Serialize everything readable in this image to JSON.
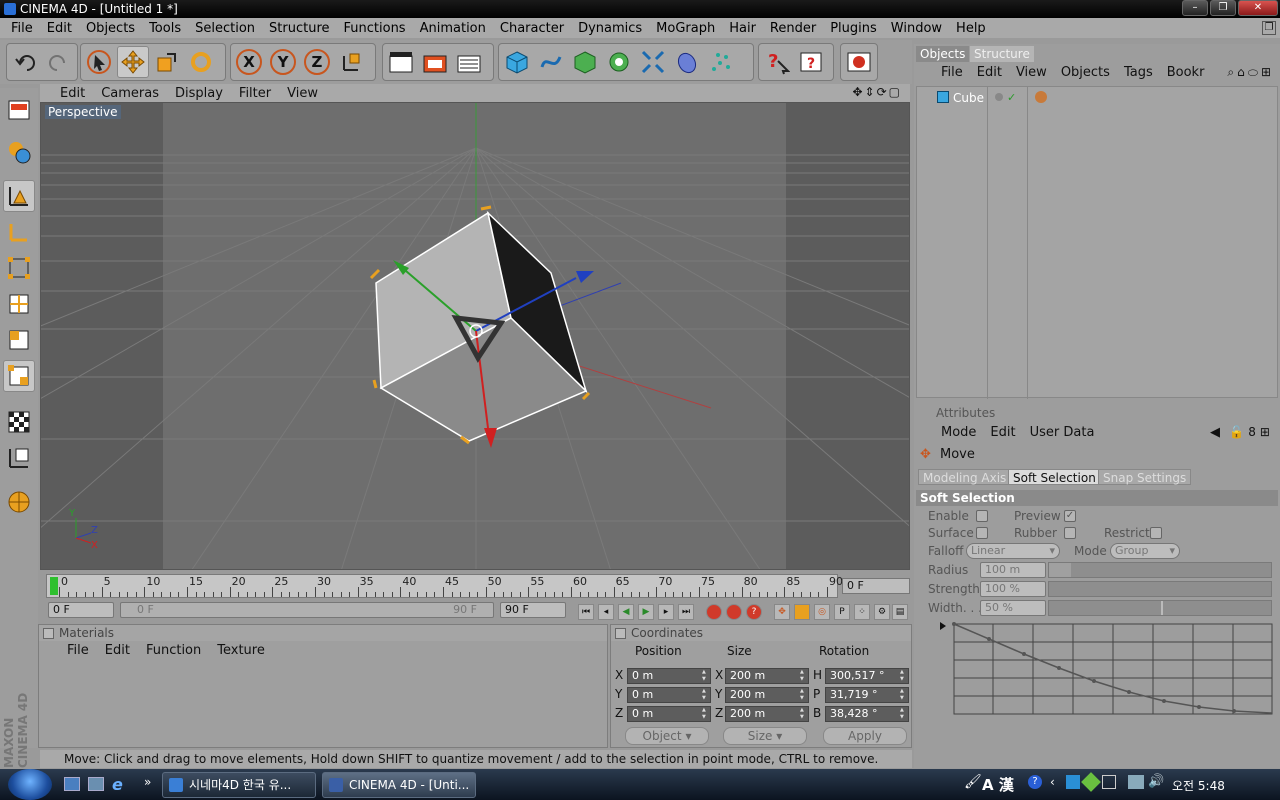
{
  "window": {
    "title": "CINEMA 4D - [Untitled 1 *]",
    "controls": [
      "–",
      "❐",
      "✕"
    ]
  },
  "menubar": [
    "File",
    "Edit",
    "Objects",
    "Tools",
    "Selection",
    "Structure",
    "Functions",
    "Animation",
    "Character",
    "Dynamics",
    "MoGraph",
    "Hair",
    "Render",
    "Plugins",
    "Window",
    "Help"
  ],
  "toolbar": {
    "axis_labels": [
      "X",
      "Y",
      "Z"
    ]
  },
  "viewport": {
    "menu": [
      "Edit",
      "Cameras",
      "Display",
      "Filter",
      "View"
    ],
    "label": "Perspective",
    "gizmo_axes": [
      "Y",
      "Z",
      "X"
    ]
  },
  "timeline": {
    "ticks": [
      "0",
      "5",
      "10",
      "15",
      "20",
      "25",
      "30",
      "35",
      "40",
      "45",
      "50",
      "55",
      "60",
      "65",
      "70",
      "75",
      "80",
      "85",
      "90"
    ],
    "current_frame": "0 F",
    "start_field": "0 F",
    "range_start": "0 F",
    "range_end": "90 F",
    "end_field": "90 F"
  },
  "materials": {
    "title": "Materials",
    "menu": [
      "File",
      "Edit",
      "Function",
      "Texture"
    ]
  },
  "coordinates": {
    "title": "Coordinates",
    "headers": [
      "Position",
      "Size",
      "Rotation"
    ],
    "rows": [
      {
        "axis": "X",
        "pos": "0 m",
        "size_axis": "X",
        "size": "200 m",
        "rot_axis": "H",
        "rot": "300,517 °"
      },
      {
        "axis": "Y",
        "pos": "0 m",
        "size_axis": "Y",
        "size": "200 m",
        "rot_axis": "P",
        "rot": "31,719 °"
      },
      {
        "axis": "Z",
        "pos": "0 m",
        "size_axis": "Z",
        "size": "200 m",
        "rot_axis": "B",
        "rot": "38,428 °"
      }
    ],
    "mode_select": "Object",
    "size_select": "Size",
    "apply_label": "Apply"
  },
  "status": "Move: Click and drag to move elements, Hold down SHIFT to quantize movement / add to the selection in point mode, CTRL to remove.",
  "brand": {
    "line1": "MAXON",
    "line2": "CINEMA 4D"
  },
  "objects_panel": {
    "tabs": [
      "Objects",
      "Structure"
    ],
    "menu": [
      "File",
      "Edit",
      "View",
      "Objects",
      "Tags",
      "Bookr"
    ],
    "items": [
      {
        "name": "Cube"
      }
    ]
  },
  "attributes": {
    "title": "Attributes",
    "menu": [
      "Mode",
      "Edit",
      "User Data"
    ],
    "tool_name": "Move",
    "tabs": [
      "Modeling Axis",
      "Soft Selection",
      "Snap Settings"
    ],
    "active_tab": "Soft Selection",
    "section": "Soft Selection",
    "enable_label": "Enable",
    "preview_label": "Preview",
    "surface_label": "Surface",
    "rubber_label": "Rubber",
    "restrict_label": "Restrict",
    "falloff_label": "Falloff",
    "falloff_value": "Linear",
    "mode_label": "Mode",
    "mode_value": "Group",
    "radius_label": "Radius",
    "radius_value": "100 m",
    "strength_label": "Strength",
    "strength_value": "100 %",
    "width_label": "Width. . .",
    "width_value": "50 %"
  },
  "taskbar": {
    "tasks": [
      "시네마4D 한국 유...",
      "CINEMA 4D - [Unti..."
    ],
    "ime": "A 漢",
    "clock": "오전 5:48"
  }
}
